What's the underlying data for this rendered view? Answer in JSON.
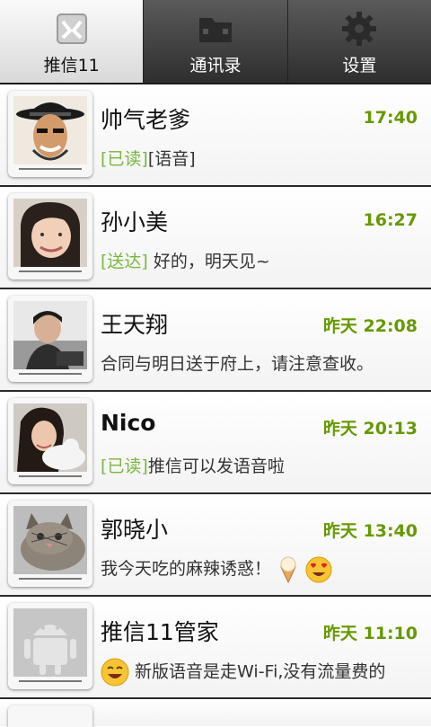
{
  "tabs": [
    {
      "label": "推信11",
      "icon": "chat-icon",
      "active": true
    },
    {
      "label": "通讯录",
      "icon": "folder-icon",
      "active": false
    },
    {
      "label": "设置",
      "icon": "gear-icon",
      "active": false
    }
  ],
  "conversations": [
    {
      "name": "帅气老爹",
      "time": "17:40",
      "status": "[已读]",
      "message": "[语音]"
    },
    {
      "name": "孙小美",
      "time": "16:27",
      "status": "[送达]",
      "message": "好的，明天见~"
    },
    {
      "name": "王天翔",
      "time": "昨天 22:08",
      "status": "",
      "message": "合同与明日送于府上，请注意查收。"
    },
    {
      "name": "Nico",
      "time": "昨天 20:13",
      "status": "[已读]",
      "message": "推信可以发语音啦"
    },
    {
      "name": "郭晓小",
      "time": "昨天 13:40",
      "status": "",
      "message": "我今天吃的麻辣诱惑！",
      "emoticons": [
        "ice-cream-emoticon",
        "heart-eyes-emoticon"
      ]
    },
    {
      "name": "推信11管家",
      "time": "昨天 11:10",
      "status": "",
      "message": "新版语音是走Wi-Fi,没有流量费的",
      "emoticons": [
        "smile-emoticon"
      ]
    }
  ],
  "colors": {
    "accent": "#669900",
    "status": "#7ab640",
    "tab_bar": "#3a3a3a"
  }
}
